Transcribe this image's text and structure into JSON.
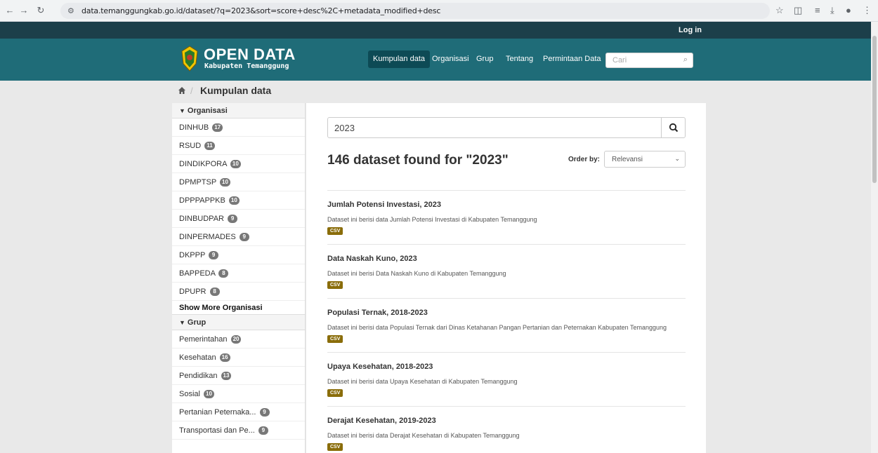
{
  "browser": {
    "url": "data.temanggungkab.go.id/dataset/?q=2023&sort=score+desc%2C+metadata_modified+desc"
  },
  "header": {
    "login": "Log in",
    "brand_title": "OPEN DATA",
    "brand_subtitle": "Kabupaten Temanggung",
    "nav": [
      "Kumpulan data",
      "Organisasi",
      "Grup",
      "Tentang",
      "Permintaan Data"
    ],
    "search_placeholder": "Cari"
  },
  "breadcrumb": {
    "current": "Kumpulan data"
  },
  "sidebar": {
    "organisasi": {
      "title": "Organisasi",
      "items": [
        {
          "label": "DINHUB",
          "count": "17"
        },
        {
          "label": "RSUD",
          "count": "11"
        },
        {
          "label": "DINDIKPORA",
          "count": "10"
        },
        {
          "label": "DPMPTSP",
          "count": "10"
        },
        {
          "label": "DPPPAPPKB",
          "count": "10"
        },
        {
          "label": "DINBUDPAR",
          "count": "9"
        },
        {
          "label": "DINPERMADES",
          "count": "9"
        },
        {
          "label": "DKPPP",
          "count": "9"
        },
        {
          "label": "BAPPEDA",
          "count": "8"
        },
        {
          "label": "DPUPR",
          "count": "8"
        }
      ],
      "show_more": "Show More Organisasi"
    },
    "grup": {
      "title": "Grup",
      "items": [
        {
          "label": "Pemerintahan",
          "count": "20"
        },
        {
          "label": "Kesehatan",
          "count": "16"
        },
        {
          "label": "Pendidikan",
          "count": "13"
        },
        {
          "label": "Sosial",
          "count": "10"
        },
        {
          "label": "Pertanian Peternaka...",
          "count": "9"
        },
        {
          "label": "Transportasi dan Pe...",
          "count": "9"
        }
      ]
    }
  },
  "main": {
    "query": "2023",
    "found_text": "146 dataset found for \"2023\"",
    "order_label": "Order by:",
    "order_value": "Relevansi",
    "results": [
      {
        "title": "Jumlah Potensi Investasi, 2023",
        "desc": "Dataset ini berisi data Jumlah Potensi Investasi di Kabupaten Temanggung",
        "format": "CSV"
      },
      {
        "title": "Data Naskah Kuno, 2023",
        "desc": "Dataset ini berisi Data Naskah Kuno di Kabupaten Temanggung",
        "format": "CSV"
      },
      {
        "title": "Populasi Ternak, 2018-2023",
        "desc": "Dataset ini berisi data Populasi Ternak dari Dinas Ketahanan Pangan Pertanian dan Peternakan Kabupaten Temanggung",
        "format": "CSV"
      },
      {
        "title": "Upaya Kesehatan, 2018-2023",
        "desc": "Dataset ini berisi data Upaya Kesehatan di Kabupaten Temanggung",
        "format": "CSV"
      },
      {
        "title": "Derajat Kesehatan, 2019-2023",
        "desc": "Dataset ini berisi data Derajat Kesehatan di Kabupaten Temanggung",
        "format": "CSV"
      }
    ]
  }
}
